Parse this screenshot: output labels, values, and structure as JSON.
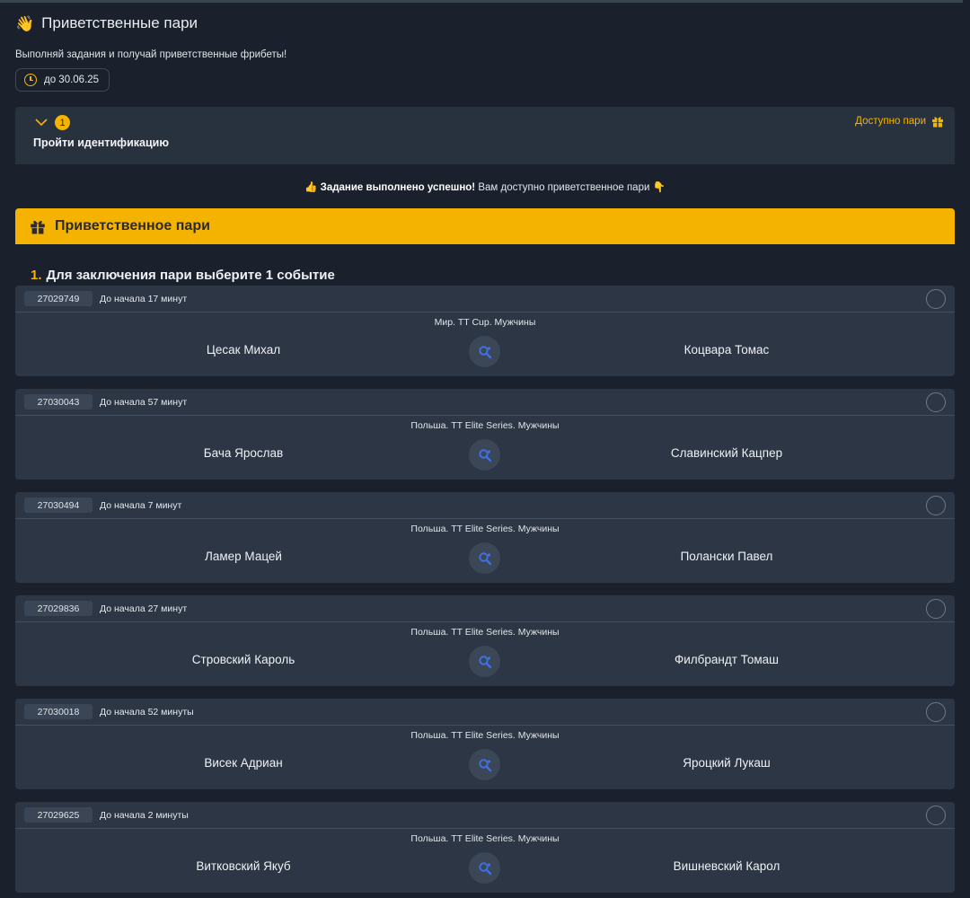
{
  "header": {
    "wave_icon": "👋",
    "title": "Приветственные пари",
    "subtitle": "Выполняй задания и получай приветственные фрибеты!",
    "date_label": "до 30.06.25"
  },
  "task": {
    "badge": "1",
    "title": "Пройти идентификацию",
    "available_label": "Доступно пари"
  },
  "success": {
    "thumb_icon": "👍",
    "bold": "Задание выполнено успешно!",
    "text": "Вам доступно приветственное пари",
    "point_icon": "👇"
  },
  "banner": {
    "title": "Приветственное пари"
  },
  "step": {
    "number": "1.",
    "text": "Для заключения пари выберите 1 событие"
  },
  "events": [
    {
      "id": "27029749",
      "time": "До начала 17 минут",
      "league": "Мир. TT Cup. Мужчины",
      "home": "Цесак Михал",
      "away": "Коцвара Томас"
    },
    {
      "id": "27030043",
      "time": "До начала 57 минут",
      "league": "Польша. TT Elite Series. Мужчины",
      "home": "Бача Ярослав",
      "away": "Славинский Кацпер"
    },
    {
      "id": "27030494",
      "time": "До начала 7 минут",
      "league": "Польша. TT Elite Series. Мужчины",
      "home": "Ламер Мацей",
      "away": "Полански Павел"
    },
    {
      "id": "27029836",
      "time": "До начала 27 минут",
      "league": "Польша. TT Elite Series. Мужчины",
      "home": "Стровский Кароль",
      "away": "Филбрандт Томаш"
    },
    {
      "id": "27030018",
      "time": "До начала 52 минуты",
      "league": "Польша. TT Elite Series. Мужчины",
      "home": "Висек Адриан",
      "away": "Яроцкий Лукаш"
    },
    {
      "id": "27029625",
      "time": "До начала 2 минуты",
      "league": "Польша. TT Elite Series. Мужчины",
      "home": "Витковский Якуб",
      "away": "Вишневский Карол"
    }
  ],
  "colors": {
    "accent": "#f4b400",
    "background": "#1b212c",
    "card": "#2c3644",
    "ball_icon": "#3f6fe0"
  }
}
